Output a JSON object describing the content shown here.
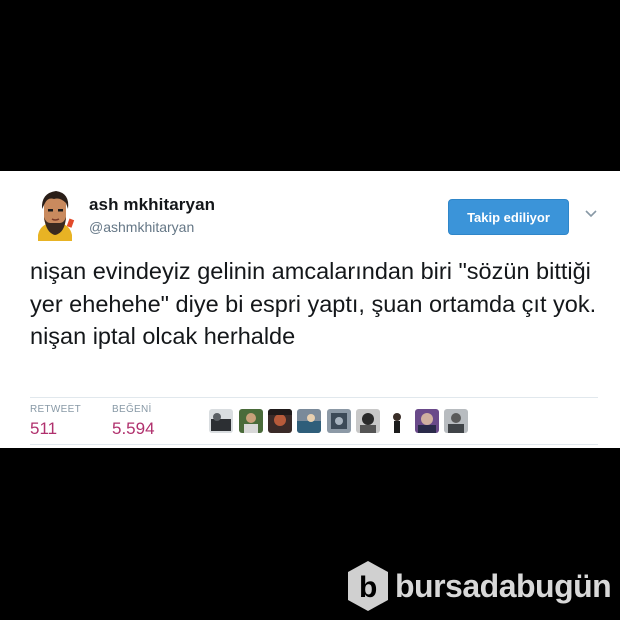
{
  "user": {
    "display_name": "ash mkhitaryan",
    "handle": "@ashmkhitaryan"
  },
  "follow_button_label": "Takip ediliyor",
  "tweet_text": "nişan evindeyiz gelinin amcalarından biri \"sözün bittiği yer ehehehe\" diye bi espri yaptı, şuan ortamda çıt yok. nişan iptal olcak herhalde",
  "stats": {
    "retweet_label": "RETWEET",
    "retweet_count": "511",
    "like_label": "BEĞENİ",
    "like_count": "5.594"
  },
  "colors": {
    "follow_blue": "#3b94d9",
    "count_color": "#b0306d",
    "handle_gray": "#657786"
  },
  "watermark": {
    "text": "bursadabugün"
  }
}
